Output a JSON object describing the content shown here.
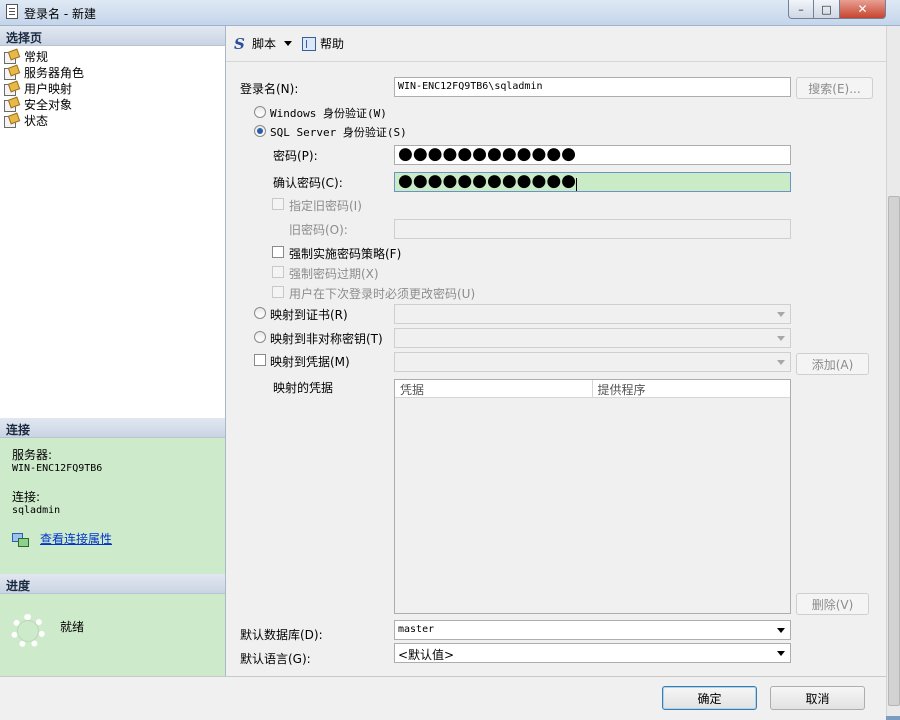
{
  "window": {
    "title": "登录名 - 新建",
    "min": "–",
    "max": "□",
    "close": "✕"
  },
  "left": {
    "select_header": "选择页",
    "pages": [
      "常规",
      "服务器角色",
      "用户映射",
      "安全对象",
      "状态"
    ],
    "connection_header": "连接",
    "server_label": "服务器:",
    "server_value": "WIN-ENC12FQ9TB6",
    "conn_label": "连接:",
    "conn_value": "sqladmin",
    "view_props_link": "查看连接属性",
    "progress_header": "进度",
    "progress_text": "就绪"
  },
  "toolbar": {
    "script": "脚本",
    "help": "帮助"
  },
  "form": {
    "login_name_label": "登录名(N):",
    "login_name_value": "WIN-ENC12FQ9TB6\\sqladmin",
    "search_button": "搜索(E)...",
    "windows_auth": "Windows 身份验证(W)",
    "sql_auth": "SQL Server 身份验证(S)",
    "password_label": "密码(P):",
    "password_value": "●●●●●●●●●●●●",
    "confirm_label": "确认密码(C):",
    "confirm_value": "●●●●●●●●●●●●",
    "specify_old": "指定旧密码(I)",
    "old_password_label": "旧密码(O):",
    "enforce_policy": "强制实施密码策略(F)",
    "enforce_expiration": "强制密码过期(X)",
    "must_change": "用户在下次登录时必须更改密码(U)",
    "map_cert": "映射到证书(R)",
    "map_asym": "映射到非对称密钥(T)",
    "map_cred": "映射到凭据(M)",
    "add_button": "添加(A)",
    "mapped_creds_label": "映射的凭据",
    "grid_cols": [
      "凭据",
      "提供程序"
    ],
    "remove_button": "删除(V)",
    "default_db_label": "默认数据库(D):",
    "default_db_value": "master",
    "default_lang_label": "默认语言(G):",
    "default_lang_value": "<默认值>"
  },
  "footer": {
    "ok": "确定",
    "cancel": "取消"
  }
}
